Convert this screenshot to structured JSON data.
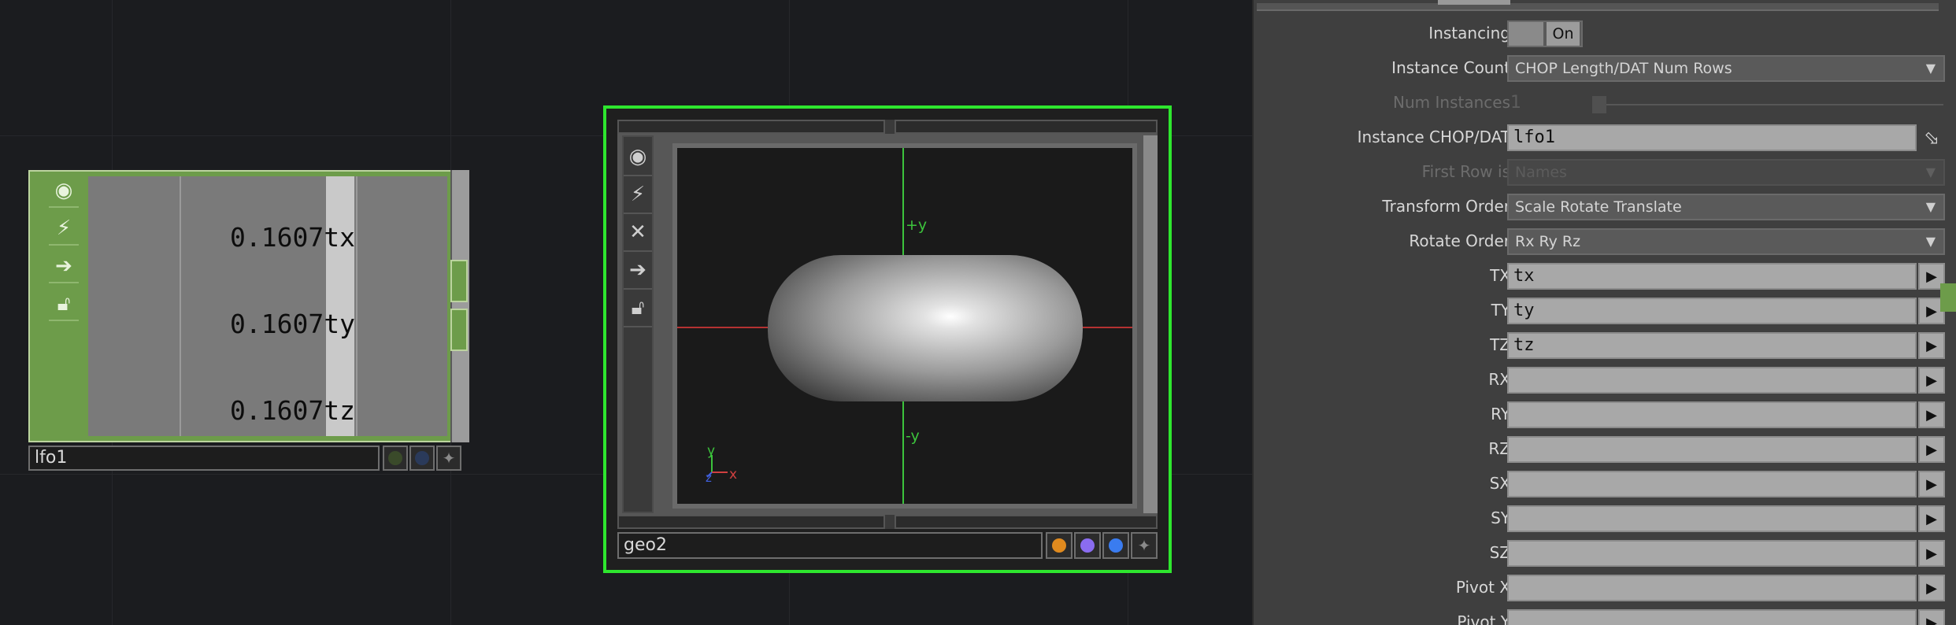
{
  "lfo_node": {
    "name": "lfo1",
    "channels": [
      {
        "value": "0.1607",
        "channel": "tx"
      },
      {
        "value": "0.1607",
        "channel": "ty"
      },
      {
        "value": "0.1607",
        "channel": "tz"
      }
    ],
    "icons": [
      "viewer-icon",
      "bypass-icon",
      "export-icon",
      "lock-icon"
    ]
  },
  "geo_node": {
    "name": "geo2",
    "axis_labels": {
      "plus_y": "+y",
      "minus_y": "-y",
      "gizmo_y": "y",
      "gizmo_x": "x",
      "gizmo_z": "z"
    },
    "icons": [
      "viewer-icon",
      "bypass-icon",
      "close-icon",
      "export-icon",
      "lock-icon"
    ],
    "flag_colors": [
      "#e08a1e",
      "#8a6cf0",
      "#3a7cf0"
    ],
    "highlight_color": "#2ee62e"
  },
  "panel": {
    "rows": [
      {
        "label": "Instancing",
        "type": "toggle",
        "value": "On"
      },
      {
        "label": "Instance Count",
        "type": "menu",
        "value": "CHOP Length/DAT Num Rows"
      },
      {
        "label": "Num Instances",
        "type": "slider",
        "value": "1",
        "disabled": true
      },
      {
        "label": "Instance CHOP/DAT",
        "type": "field",
        "value": "lfo1"
      },
      {
        "label": "First Row is",
        "type": "menu",
        "value": "Names",
        "disabled": true
      },
      {
        "label": "Transform Order",
        "type": "menu",
        "value": "Scale Rotate Translate"
      },
      {
        "label": "Rotate Order",
        "type": "menu",
        "value": "Rx Ry Rz"
      },
      {
        "label": "TX",
        "type": "field",
        "value": "tx"
      },
      {
        "label": "TY",
        "type": "field",
        "value": "ty"
      },
      {
        "label": "TZ",
        "type": "field",
        "value": "tz"
      },
      {
        "label": "RX",
        "type": "field",
        "value": ""
      },
      {
        "label": "RY",
        "type": "field",
        "value": ""
      },
      {
        "label": "RZ",
        "type": "field",
        "value": ""
      },
      {
        "label": "SX",
        "type": "field",
        "value": ""
      },
      {
        "label": "SY",
        "type": "field",
        "value": ""
      },
      {
        "label": "SZ",
        "type": "field",
        "value": ""
      },
      {
        "label": "Pivot X",
        "type": "field",
        "value": ""
      },
      {
        "label": "Pivot Y",
        "type": "field",
        "value": ""
      }
    ]
  }
}
